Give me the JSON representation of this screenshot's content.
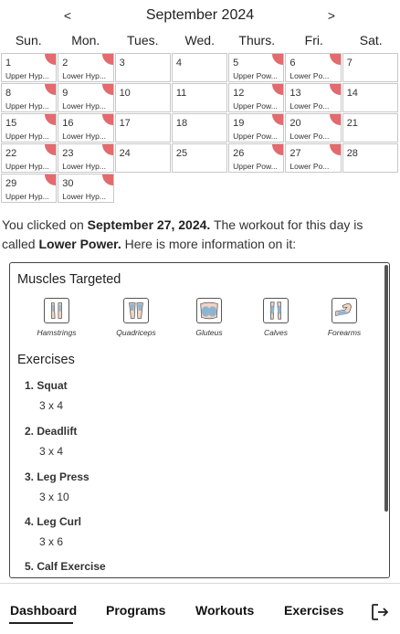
{
  "calendar": {
    "prev_label": "<",
    "next_label": ">",
    "month_title": "September 2024",
    "days_of_week": [
      "Sun.",
      "Mon.",
      "Tues.",
      "Wed.",
      "Thurs.",
      "Fri.",
      "Sat."
    ],
    "weeks": [
      [
        {
          "day": "1",
          "workout": "Upper Hyp...",
          "flag": true
        },
        {
          "day": "2",
          "workout": "Lower Hyp...",
          "flag": true
        },
        {
          "day": "3",
          "workout": "",
          "flag": false
        },
        {
          "day": "4",
          "workout": "",
          "flag": false
        },
        {
          "day": "5",
          "workout": "Upper Pow...",
          "flag": true
        },
        {
          "day": "6",
          "workout": "Lower Po...",
          "flag": true
        },
        {
          "day": "7",
          "workout": "",
          "flag": false
        }
      ],
      [
        {
          "day": "8",
          "workout": "Upper Hyp...",
          "flag": true
        },
        {
          "day": "9",
          "workout": "Lower Hyp...",
          "flag": true
        },
        {
          "day": "10",
          "workout": "",
          "flag": false
        },
        {
          "day": "11",
          "workout": "",
          "flag": false
        },
        {
          "day": "12",
          "workout": "Upper Pow...",
          "flag": true
        },
        {
          "day": "13",
          "workout": "Lower Po...",
          "flag": true
        },
        {
          "day": "14",
          "workout": "",
          "flag": false
        }
      ],
      [
        {
          "day": "15",
          "workout": "Upper Hyp...",
          "flag": true
        },
        {
          "day": "16",
          "workout": "Lower Hyp...",
          "flag": true
        },
        {
          "day": "17",
          "workout": "",
          "flag": false
        },
        {
          "day": "18",
          "workout": "",
          "flag": false
        },
        {
          "day": "19",
          "workout": "Upper Pow...",
          "flag": true
        },
        {
          "day": "20",
          "workout": "Lower Po...",
          "flag": true
        },
        {
          "day": "21",
          "workout": "",
          "flag": false
        }
      ],
      [
        {
          "day": "22",
          "workout": "Upper Hyp...",
          "flag": true
        },
        {
          "day": "23",
          "workout": "Lower Hyp...",
          "flag": true
        },
        {
          "day": "24",
          "workout": "",
          "flag": false
        },
        {
          "day": "25",
          "workout": "",
          "flag": false
        },
        {
          "day": "26",
          "workout": "Upper Pow...",
          "flag": true
        },
        {
          "day": "27",
          "workout": "Lower Po...",
          "flag": true
        },
        {
          "day": "28",
          "workout": "",
          "flag": false
        }
      ],
      [
        {
          "day": "29",
          "workout": "Upper Hyp...",
          "flag": true
        },
        {
          "day": "30",
          "workout": "Lower Hyp...",
          "flag": true
        }
      ]
    ],
    "flag_color": "#e46a6e"
  },
  "info": {
    "prefix": "You clicked on ",
    "date": "September 27, 2024.",
    "middle": " The workout for this day is called ",
    "workout": "Lower Power.",
    "suffix": " Here is more information on it:"
  },
  "details": {
    "muscles_title": "Muscles Targeted",
    "muscles": [
      {
        "label": "Hamstrings",
        "icon": "hamstrings-icon"
      },
      {
        "label": "Quadriceps",
        "icon": "quadriceps-icon"
      },
      {
        "label": "Gluteus",
        "icon": "gluteus-icon"
      },
      {
        "label": "Calves",
        "icon": "calves-icon"
      },
      {
        "label": "Forearms",
        "icon": "forearms-icon"
      }
    ],
    "exercises_title": "Exercises",
    "exercises": [
      {
        "name": "1. Squat",
        "sets": "3 x 4"
      },
      {
        "name": "2. Deadlift",
        "sets": "3 x 4"
      },
      {
        "name": "3. Leg Press",
        "sets": "3 x 10"
      },
      {
        "name": "4. Leg Curl",
        "sets": "3 x 6"
      },
      {
        "name": "5. Calf Exercise",
        "sets": ""
      }
    ]
  },
  "nav": {
    "tabs": [
      "Dashboard",
      "Programs",
      "Workouts",
      "Exercises"
    ],
    "active": "Dashboard",
    "logout_icon": "logout-icon"
  }
}
